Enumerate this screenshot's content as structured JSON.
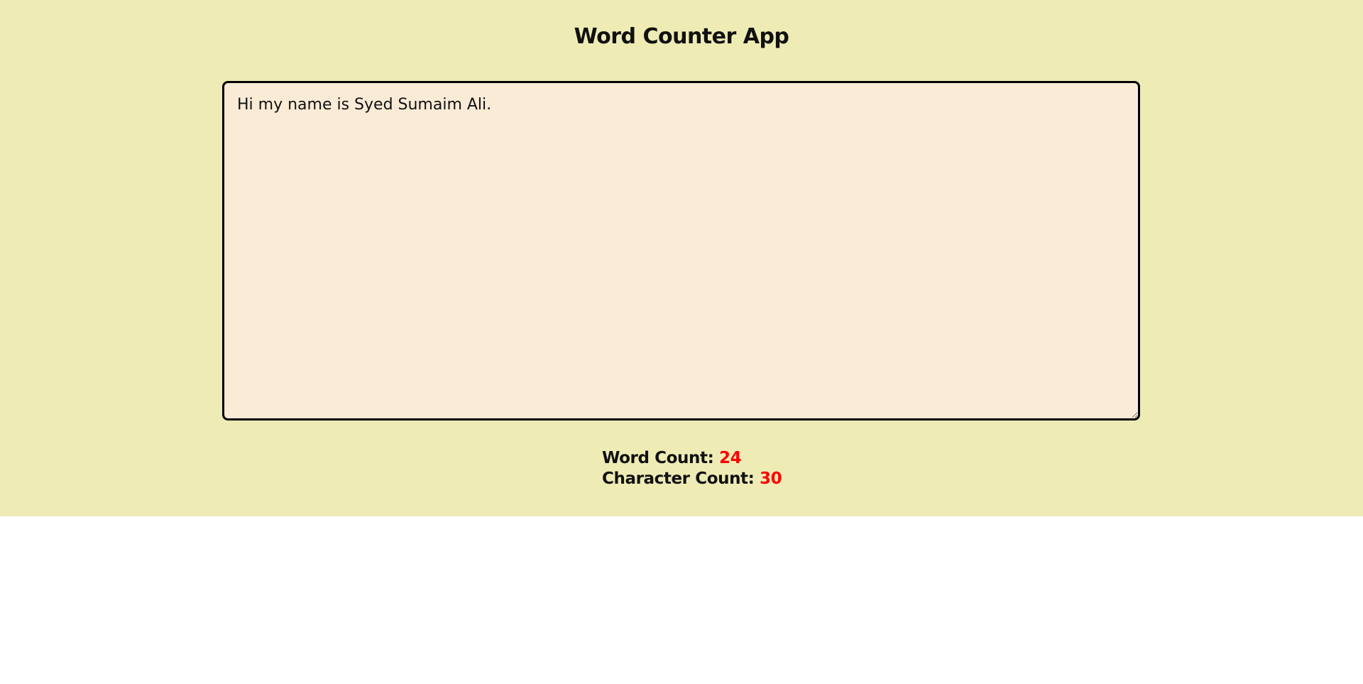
{
  "app": {
    "title": "Word Counter App"
  },
  "editor": {
    "value": "Hi my name is Syed Sumaim Ali."
  },
  "stats": {
    "word_label": "Word Count: ",
    "word_value": "24",
    "char_label": "Character Count: ",
    "char_value": "30"
  },
  "colors": {
    "background": "#eeebb5",
    "textarea_background": "#faebd7",
    "count_accent": "#ff0000"
  }
}
